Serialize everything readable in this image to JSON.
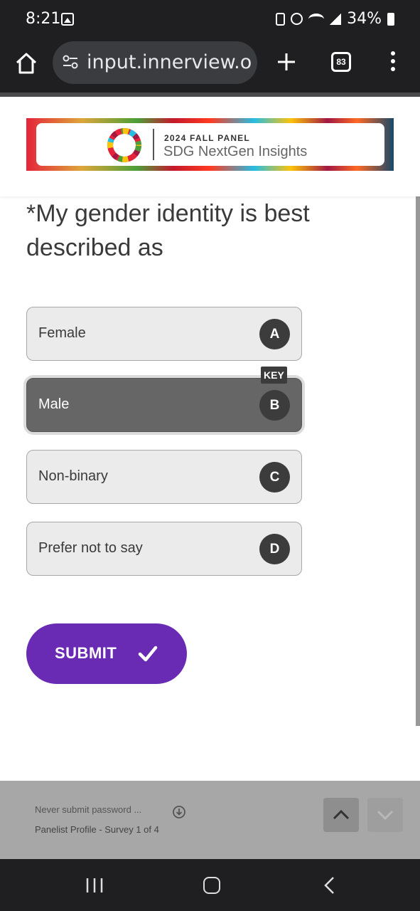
{
  "status_bar": {
    "time": "8:21",
    "battery": "34%",
    "icons": [
      "image-icon",
      "battery-saver-icon",
      "alarm-icon",
      "wifi-icon",
      "signal-icon",
      "battery-icon"
    ]
  },
  "browser": {
    "url": "input.innerview.org",
    "tab_count": "83"
  },
  "banner": {
    "subtitle": "2024 FALL PANEL",
    "title": "SDG NextGen Insights"
  },
  "question": {
    "text": "*My gender identity is best described as"
  },
  "options": [
    {
      "label": "Female",
      "key": "A",
      "selected": false
    },
    {
      "label": "Male",
      "key": "B",
      "selected": true
    },
    {
      "label": "Non-binary",
      "key": "C",
      "selected": false
    },
    {
      "label": "Prefer not to say",
      "key": "D",
      "selected": false
    }
  ],
  "key_hint": "KEY",
  "submit": {
    "label": "SUBMIT"
  },
  "footer": {
    "warning": "Never submit password  ...",
    "progress": "Panelist Profile - Survey 1 of 4"
  },
  "colors": {
    "accent": "#6a2bb4",
    "selected_option": "#666666",
    "option_bg": "#ebebeb",
    "footer_bg": "#a7a7a7"
  }
}
